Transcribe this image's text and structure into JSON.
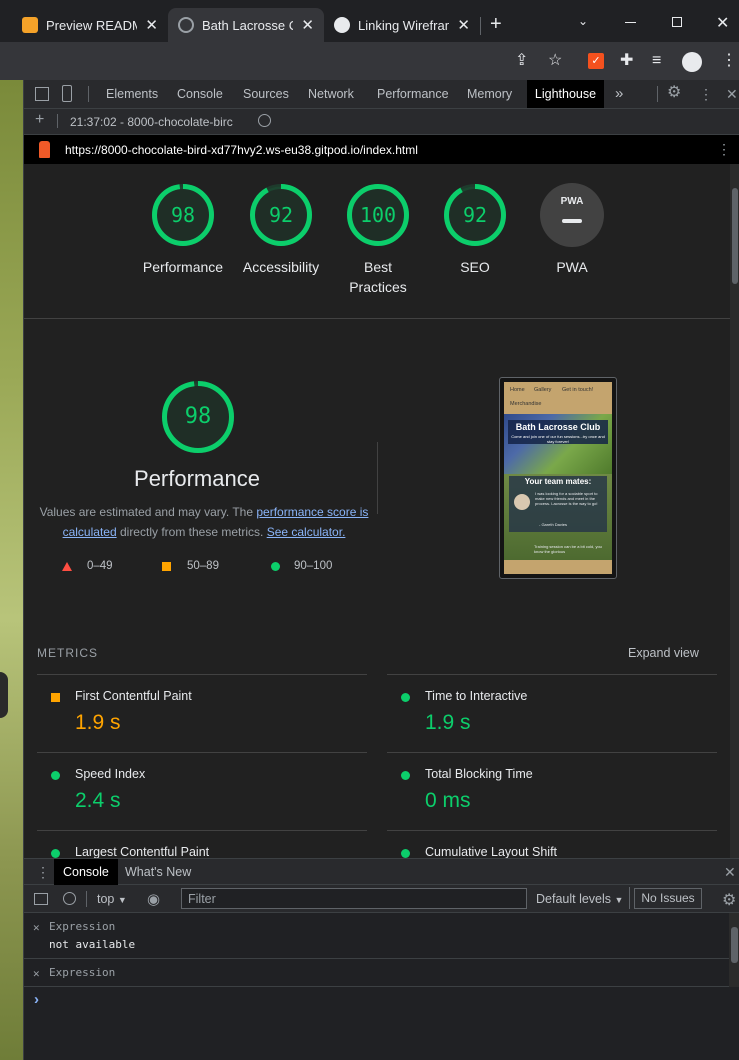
{
  "browser": {
    "tabs": [
      {
        "title": "Preview README.",
        "favicon_color": "#f4a229"
      },
      {
        "title": "Bath Lacrosse Clu",
        "favicon_color": "#9aa0a6"
      },
      {
        "title": "Linking Wirefram",
        "favicon_color": "#e8eaed"
      }
    ],
    "new_tab_label": "+"
  },
  "devtools": {
    "tabs": [
      "Elements",
      "Console",
      "Sources",
      "Network",
      "Performance",
      "Memory",
      "Lighthouse"
    ],
    "active_tab": "Lighthouse",
    "more_label": "»",
    "report_selector": "21:37:02 - 8000-chocolate-birc",
    "url": "https://8000-chocolate-bird-xd77hvy2.ws-eu38.gitpod.io/index.html"
  },
  "lighthouse": {
    "summary": [
      {
        "label": "Performance",
        "score": "98",
        "fraction": 0.98
      },
      {
        "label": "Accessibility",
        "score": "92",
        "fraction": 0.92
      },
      {
        "label": "Best Practices",
        "label_line1": "Best",
        "label_line2": "Practices",
        "score": "100",
        "fraction": 1.0
      },
      {
        "label": "SEO",
        "score": "92",
        "fraction": 0.92
      },
      {
        "label": "PWA",
        "badge": "PWA"
      }
    ],
    "performance": {
      "score": "98",
      "fraction": 0.98,
      "title": "Performance",
      "note_before": "Values are estimated and may vary. The ",
      "note_link": "performance score is calculated",
      "note_mid": " directly from these metrics. ",
      "note_link2": "See calculator.",
      "legend": [
        {
          "range": "0–49",
          "color": "#ff4e42"
        },
        {
          "range": "50–89",
          "color": "#ffa400"
        },
        {
          "range": "90–100",
          "color": "#0cce6b"
        }
      ]
    },
    "screenshot": {
      "nav": [
        "Home",
        "Gallery",
        "Get in touch!"
      ],
      "nav2": "Merchandise",
      "title": "Bath Lacrosse Club",
      "subtitle": "Come and join one of our fun sessions...try once and stay forever!",
      "section": "Your team mates:",
      "quote": "I was looking for a sociable sport to make new friends and meet in the process. Lacrosse is the way to go!",
      "author": "- Gareth Davies",
      "footer_text": "Training session can be a bit cold, you know the glorious"
    },
    "metrics_heading": "METRICS",
    "expand_label": "Expand view",
    "metrics": [
      {
        "name": "First Contentful Paint",
        "value": "1.9 s",
        "status": "average",
        "color": "#ffa400"
      },
      {
        "name": "Time to Interactive",
        "value": "1.9 s",
        "status": "pass",
        "color": "#0cce6b"
      },
      {
        "name": "Speed Index",
        "value": "2.4 s",
        "status": "pass",
        "color": "#0cce6b"
      },
      {
        "name": "Total Blocking Time",
        "value": "0 ms",
        "status": "pass",
        "color": "#0cce6b"
      },
      {
        "name": "Largest Contentful Paint",
        "value": "",
        "status": "pass",
        "color": "#0cce6b"
      },
      {
        "name": "Cumulative Layout Shift",
        "value": "",
        "status": "pass",
        "color": "#0cce6b"
      }
    ]
  },
  "console_drawer": {
    "tabs": [
      "Console",
      "What's New"
    ],
    "context": "top",
    "filter_placeholder": "Filter",
    "levels": "Default levels",
    "issues": "No Issues",
    "expressions": [
      {
        "label": "Expression",
        "value": "not available"
      },
      {
        "label": "Expression",
        "value": ""
      }
    ],
    "prompt": "›"
  }
}
